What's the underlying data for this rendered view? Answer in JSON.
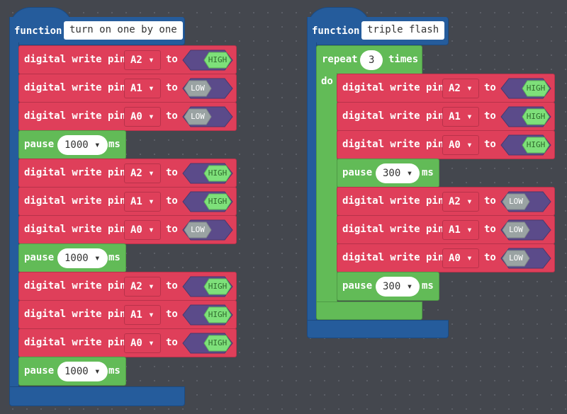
{
  "colors": {
    "function": "#255c9c",
    "pins": "#df3f5a",
    "loops": "#62bb57",
    "boolean": "#5b4b8a",
    "high": "#7ee07a",
    "low": "#9aa3a3"
  },
  "labels": {
    "function": "function",
    "digital_write": "digital write pin",
    "to": "to",
    "pause": "pause",
    "ms": "ms",
    "repeat": "repeat",
    "times": "times",
    "do": "do",
    "dropdown_icon": "caret-down-icon"
  },
  "functions": [
    {
      "name": "turn on one by one",
      "blocks": [
        {
          "type": "write",
          "pin": "A2",
          "value": "HIGH"
        },
        {
          "type": "write",
          "pin": "A1",
          "value": "LOW"
        },
        {
          "type": "write",
          "pin": "A0",
          "value": "LOW"
        },
        {
          "type": "pause",
          "ms": "1000"
        },
        {
          "type": "write",
          "pin": "A2",
          "value": "HIGH"
        },
        {
          "type": "write",
          "pin": "A1",
          "value": "HIGH"
        },
        {
          "type": "write",
          "pin": "A0",
          "value": "LOW"
        },
        {
          "type": "pause",
          "ms": "1000"
        },
        {
          "type": "write",
          "pin": "A2",
          "value": "HIGH"
        },
        {
          "type": "write",
          "pin": "A1",
          "value": "HIGH"
        },
        {
          "type": "write",
          "pin": "A0",
          "value": "HIGH"
        },
        {
          "type": "pause",
          "ms": "1000"
        }
      ]
    },
    {
      "name": "triple flash",
      "repeat": {
        "times": "3",
        "blocks": [
          {
            "type": "write",
            "pin": "A2",
            "value": "HIGH"
          },
          {
            "type": "write",
            "pin": "A1",
            "value": "HIGH"
          },
          {
            "type": "write",
            "pin": "A0",
            "value": "HIGH"
          },
          {
            "type": "pause",
            "ms": "300"
          },
          {
            "type": "write",
            "pin": "A2",
            "value": "LOW"
          },
          {
            "type": "write",
            "pin": "A1",
            "value": "LOW"
          },
          {
            "type": "write",
            "pin": "A0",
            "value": "LOW"
          },
          {
            "type": "pause",
            "ms": "300"
          }
        ]
      }
    }
  ]
}
